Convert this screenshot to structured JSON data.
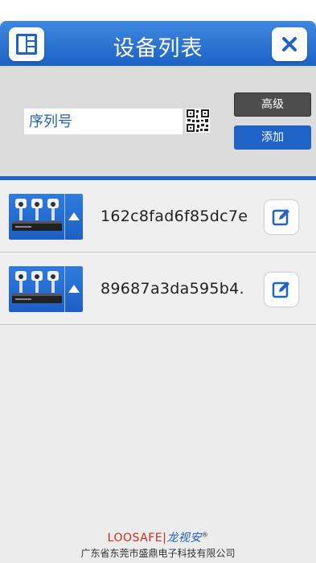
{
  "header": {
    "title": "设备列表",
    "left_icon": "list-menu-icon",
    "right_icon": "close-icon"
  },
  "search": {
    "serial_placeholder": "序列号",
    "qr_icon": "qr-code-icon",
    "advanced_label": "高级",
    "add_label": "添加"
  },
  "devices": [
    {
      "serial": "162c8fad6f85dc7e",
      "thumb_icon": "camera-dvr-icon",
      "action_icon": "edit-icon"
    },
    {
      "serial": "89687a3da595b4.",
      "thumb_icon": "camera-dvr-icon",
      "action_icon": "edit-icon"
    }
  ],
  "footer": {
    "brand_en": "LOOSAFE",
    "brand_cn": "龙视安",
    "registered": "®",
    "company": "广东省东莞市盛鼎电子科技有限公司"
  },
  "colors": {
    "header_blue": "#1d62c6",
    "add_button": "#1f63c6",
    "advanced_button": "#4d4d4d",
    "brand_red": "#d42a1e"
  }
}
